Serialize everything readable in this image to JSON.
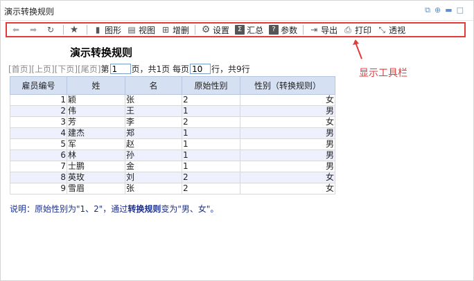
{
  "window": {
    "title": "演示转换规则"
  },
  "toolbar": {
    "items": [
      {
        "label": "",
        "icon": "arrow-left-icon"
      },
      {
        "label": "",
        "icon": "arrow-right-icon"
      },
      {
        "label": "",
        "icon": "refresh-icon"
      },
      {
        "label": "",
        "icon": "star-icon"
      },
      {
        "label": "图形",
        "icon": "bar-chart-icon"
      },
      {
        "label": "视图",
        "icon": "view-icon"
      },
      {
        "label": "增删",
        "icon": "add-delete-icon"
      },
      {
        "label": "设置",
        "icon": "gear-icon"
      },
      {
        "label": "汇总",
        "icon": "sigma-icon"
      },
      {
        "label": "参数",
        "icon": "question-icon"
      },
      {
        "label": "导出",
        "icon": "export-icon"
      },
      {
        "label": "打印",
        "icon": "printer-icon"
      },
      {
        "label": "透视",
        "icon": "pivot-icon"
      }
    ]
  },
  "annotation": {
    "label": "显示工具栏"
  },
  "report": {
    "title": "演示转换规则",
    "pager": {
      "first": "[首页]",
      "prev": "[上页]",
      "next": "[下页]",
      "last": "[尾页]",
      "page_prefix": "第",
      "page_value": "1",
      "page_suffix": "页，共1页 每页",
      "per_page_value": "10",
      "per_page_suffix": "行，共9行"
    },
    "columns": [
      "雇员编号",
      "姓",
      "名",
      "原始性别",
      "性别（转换规则）"
    ],
    "rows": [
      [
        "1",
        "颖",
        "张",
        "2",
        "女"
      ],
      [
        "2",
        "伟",
        "王",
        "1",
        "男"
      ],
      [
        "3",
        "芳",
        "李",
        "2",
        "女"
      ],
      [
        "4",
        "建杰",
        "郑",
        "1",
        "男"
      ],
      [
        "5",
        "军",
        "赵",
        "1",
        "男"
      ],
      [
        "6",
        "林",
        "孙",
        "1",
        "男"
      ],
      [
        "7",
        "士鹏",
        "金",
        "1",
        "男"
      ],
      [
        "8",
        "英玫",
        "刘",
        "2",
        "女"
      ],
      [
        "9",
        "雪眉",
        "张",
        "2",
        "女"
      ]
    ],
    "note": {
      "prefix": "说明：原始性别为\"1、2\"，通过",
      "bold": "转换规则",
      "suffix": "变为\"男、女\"。"
    }
  },
  "colors": {
    "accent": "#e23a3a",
    "header_bg": "#d5e0f2",
    "alt_row_bg": "#eef0fd"
  }
}
